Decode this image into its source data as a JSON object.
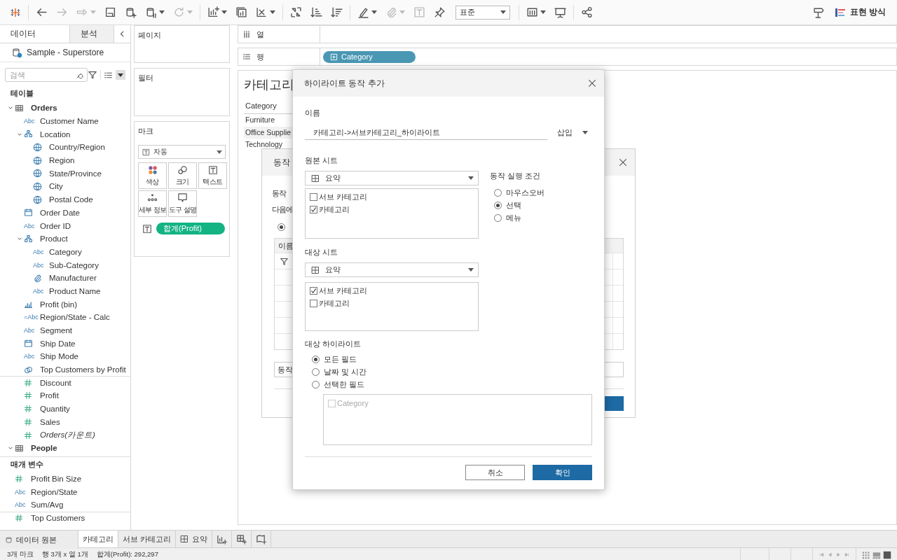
{
  "toolbar": [
    {
      "kind": "logo"
    },
    {
      "kind": "divider"
    },
    {
      "kind": "back",
      "disabled": false,
      "menu": false
    },
    {
      "kind": "forward",
      "disabled": true,
      "menu": false
    },
    {
      "kind": "run-update",
      "disabled": true,
      "menu": true
    },
    {
      "kind": "save",
      "disabled": false,
      "menu": false
    },
    {
      "kind": "new-data-source",
      "disabled": false,
      "menu": false
    },
    {
      "kind": "pause-updates",
      "disabled": false,
      "menu": true
    },
    {
      "kind": "refresh",
      "disabled": true,
      "menu": true
    },
    {
      "kind": "divider"
    },
    {
      "kind": "new-sheet",
      "disabled": false,
      "menu": true
    },
    {
      "kind": "duplicate-sheet",
      "disabled": false,
      "menu": false
    },
    {
      "kind": "clear-sheet",
      "disabled": false,
      "menu": true
    },
    {
      "kind": "divider"
    },
    {
      "kind": "swap",
      "disabled": false,
      "menu": false
    },
    {
      "kind": "sort-ascending",
      "disabled": false,
      "menu": false
    },
    {
      "kind": "sort-descending",
      "disabled": false,
      "menu": false
    },
    {
      "kind": "divider"
    },
    {
      "kind": "highlight",
      "disabled": false,
      "menu": true
    },
    {
      "kind": "group",
      "disabled": true,
      "menu": true
    },
    {
      "kind": "labels",
      "disabled": true,
      "menu": false
    },
    {
      "kind": "pin",
      "disabled": false,
      "menu": false
    },
    {
      "kind": "fit",
      "value": "표준"
    },
    {
      "kind": "divider"
    },
    {
      "kind": "cards",
      "disabled": false,
      "menu": true
    },
    {
      "kind": "presentation",
      "disabled": false,
      "menu": false
    },
    {
      "kind": "divider"
    },
    {
      "kind": "share",
      "disabled": false,
      "menu": false
    },
    {
      "kind": "spacer"
    },
    {
      "kind": "tooltip-sign",
      "disabled": false,
      "menu": false
    },
    {
      "kind": "show-me",
      "label": "표현 방식"
    }
  ],
  "sidebar": {
    "tabs": [
      {
        "label": "데이터",
        "selected": true
      },
      {
        "label": "분석",
        "selected": false
      }
    ],
    "data_source": "Sample - Superstore",
    "search": {
      "placeholder": "검색"
    },
    "tables_heading": "테이블",
    "tables": [
      {
        "label": "Orders",
        "kind": "table",
        "expanded": true,
        "children": [
          {
            "label": "Customer Name",
            "kind": "dimension",
            "type_label": "Abc"
          },
          {
            "label": "Location",
            "kind": "hierarchy",
            "expanded": true,
            "children": [
              {
                "label": "Country/Region",
                "kind": "geo"
              },
              {
                "label": "Region",
                "kind": "geo"
              },
              {
                "label": "State/Province",
                "kind": "geo"
              },
              {
                "label": "City",
                "kind": "geo"
              },
              {
                "label": "Postal Code",
                "kind": "geo"
              }
            ]
          },
          {
            "label": "Order Date",
            "kind": "date"
          },
          {
            "label": "Order ID",
            "kind": "dimension",
            "type_label": "Abc"
          },
          {
            "label": "Product",
            "kind": "hierarchy",
            "expanded": true,
            "children": [
              {
                "label": "Category",
                "kind": "dimension",
                "type_label": "Abc"
              },
              {
                "label": "Sub-Category",
                "kind": "dimension",
                "type_label": "Abc"
              },
              {
                "label": "Manufacturer",
                "kind": "group"
              },
              {
                "label": "Product Name",
                "kind": "dimension",
                "type_label": "Abc"
              }
            ]
          },
          {
            "label": "Profit (bin)",
            "kind": "bin"
          },
          {
            "label": "Region/State - Calc",
            "kind": "dimension",
            "type_label": "=Abc"
          },
          {
            "label": "Segment",
            "kind": "dimension",
            "type_label": "Abc"
          },
          {
            "label": "Ship Date",
            "kind": "date"
          },
          {
            "label": "Ship Mode",
            "kind": "dimension",
            "type_label": "Abc"
          },
          {
            "label": "Top Customers by Profit",
            "kind": "set"
          },
          {
            "label": "Discount",
            "kind": "measure"
          },
          {
            "label": "Profit",
            "kind": "measure"
          },
          {
            "label": "Quantity",
            "kind": "measure"
          },
          {
            "label": "Sales",
            "kind": "measure"
          },
          {
            "label": "Orders(카운트)",
            "kind": "measure-count"
          }
        ]
      },
      {
        "label": "People",
        "kind": "table",
        "expanded": true
      }
    ],
    "parameters_heading": "매개 변수",
    "parameters": [
      {
        "label": "Profit Bin Size",
        "kind": "measure"
      },
      {
        "label": "Region/State",
        "kind": "dimension",
        "type_label": "Abc"
      },
      {
        "label": "Sum/Avg",
        "kind": "dimension",
        "type_label": "Abc"
      },
      {
        "label": "Top Customers",
        "kind": "measure"
      }
    ]
  },
  "pages_card": {
    "title": "페이지"
  },
  "filters_card": {
    "title": "필터"
  },
  "marks_card": {
    "title": "마크",
    "mark_type": "자동",
    "buttons": [
      {
        "kind": "color",
        "label": "색상"
      },
      {
        "kind": "size",
        "label": "크기"
      },
      {
        "kind": "text",
        "label": "텍스트"
      },
      {
        "kind": "detail",
        "label": "세부 정보"
      },
      {
        "kind": "tooltip",
        "label": "도구 설명"
      }
    ],
    "pills": [
      {
        "kind": "text",
        "label": "합계(Profit)"
      }
    ]
  },
  "columns_shelf": {
    "label": "열"
  },
  "rows_shelf": {
    "label": "행",
    "pills": [
      {
        "label": "Category"
      }
    ]
  },
  "view": {
    "title": "카테고리",
    "header": "Category",
    "rows": [
      "Furniture",
      "Office Supplie",
      "Technology"
    ]
  },
  "actions_dialog": {
    "title": "동작",
    "lines": [
      "동작",
      "다음에"
    ],
    "radio_selected": true,
    "table_header": "이름",
    "field_value": "동작"
  },
  "highlight_dialog": {
    "title": "하이라이트 동작 추가",
    "name_label": "이름",
    "name_value": "카테고리->서브카테고리_하이라이트",
    "insert_label": "삽입",
    "source_label": "원본 시트",
    "source_sheet": "요약",
    "source_items": [
      {
        "label": "서브 카테고리",
        "checked": false
      },
      {
        "label": "카테고리",
        "checked": true
      }
    ],
    "run_label": "동작 실행 조건",
    "run_options": [
      {
        "label": "마우스오버",
        "selected": false
      },
      {
        "label": "선택",
        "selected": true
      },
      {
        "label": "메뉴",
        "selected": false
      }
    ],
    "target_label": "대상 시트",
    "target_sheet": "요약",
    "target_items": [
      {
        "label": "서브 카테고리",
        "checked": true
      },
      {
        "label": "카테고리",
        "checked": false
      }
    ],
    "highlight_label": "대상 하이라이트",
    "highlight_options": [
      {
        "label": "모든 필드",
        "selected": true
      },
      {
        "label": "날짜 및 시간",
        "selected": false
      },
      {
        "label": "선택한 필드",
        "selected": false
      }
    ],
    "fields": [
      {
        "label": "Category",
        "checked": false,
        "disabled": true
      }
    ],
    "cancel": "취소",
    "ok": "확인"
  },
  "sheet_tabs": [
    {
      "kind": "data-source",
      "label": "데이터 원본",
      "selected": false
    },
    {
      "kind": "sheet",
      "label": "카테고리",
      "selected": true
    },
    {
      "kind": "sheet",
      "label": "서브 카테고리",
      "selected": false
    },
    {
      "kind": "dashboard",
      "label": "요약",
      "selected": false
    }
  ],
  "new_tabs": [
    {
      "kind": "new-worksheet"
    },
    {
      "kind": "new-dashboard"
    },
    {
      "kind": "new-story"
    }
  ],
  "status_bar": {
    "items": [
      "3개 마크",
      "행 3개 x 열 1개",
      "합계(Profit): 292,297"
    ]
  }
}
